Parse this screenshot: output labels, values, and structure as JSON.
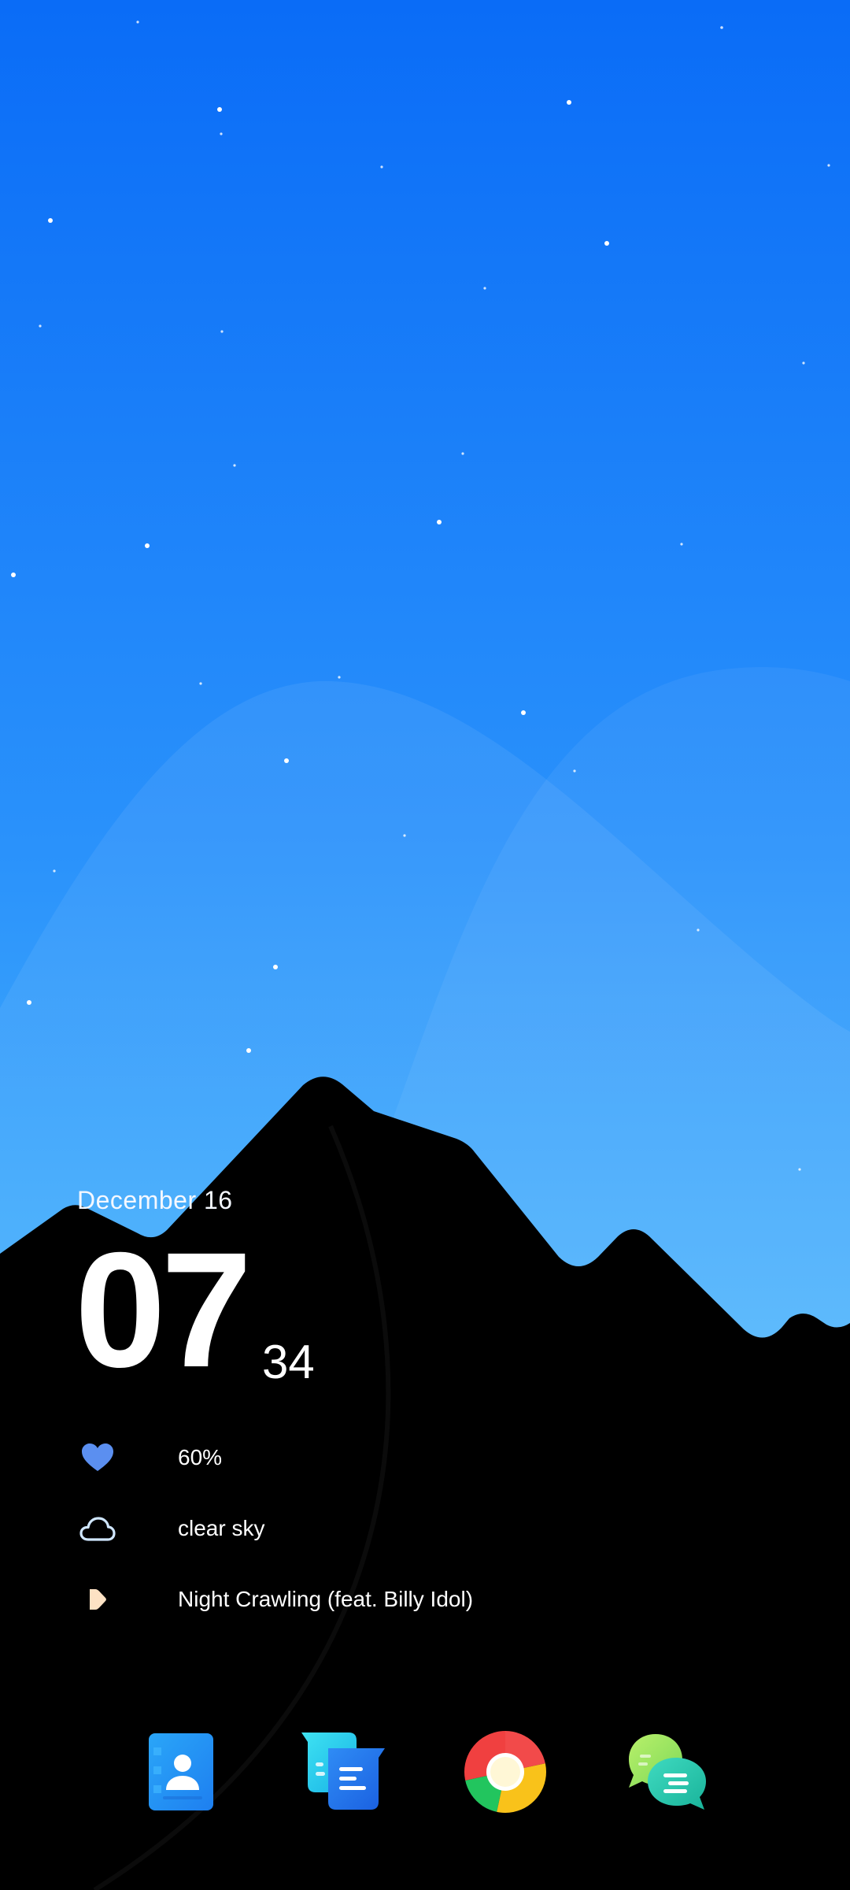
{
  "lockscreen": {
    "date": "December 16",
    "time": {
      "hour": "07",
      "minute": "34"
    },
    "battery": {
      "icon": "heart-icon",
      "text": "60%",
      "color": "#5b8ff0"
    },
    "weather": {
      "icon": "cloud-icon",
      "text": "clear sky"
    },
    "music": {
      "icon": "play-icon",
      "text": "Night Crawling (feat. Billy Idol)"
    }
  },
  "dock": {
    "apps": [
      {
        "icon": "contacts-icon"
      },
      {
        "icon": "messages-icon"
      },
      {
        "icon": "chrome-icon"
      },
      {
        "icon": "chat-icon"
      }
    ]
  },
  "colors": {
    "sky_top": "#0a6cf7",
    "sky_bottom": "#4fb6fb",
    "mountain": "#000000",
    "accent_heart": "#5b8ff0"
  }
}
